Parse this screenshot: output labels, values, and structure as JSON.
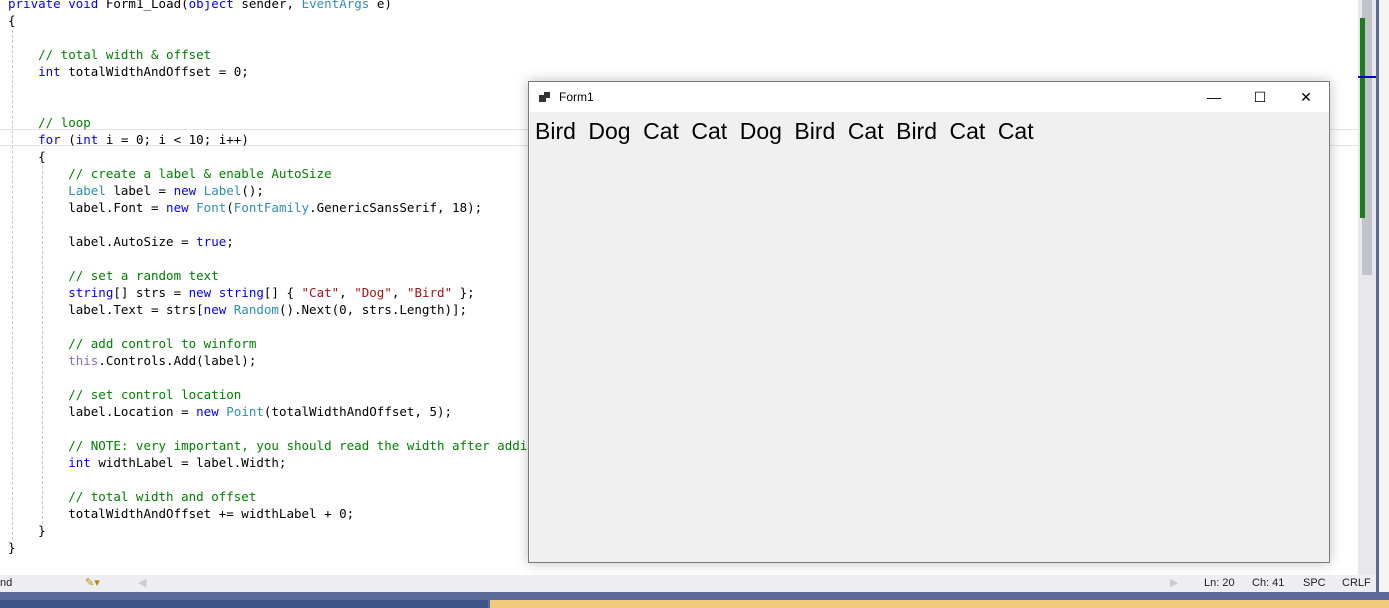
{
  "code_lines": [
    [
      [
        "kw",
        "private "
      ],
      [
        "kw",
        "void "
      ],
      [
        "",
        "Form1_Load("
      ],
      [
        "kw",
        "object "
      ],
      [
        "",
        "sender, "
      ],
      [
        "ty",
        "EventArgs "
      ],
      [
        "",
        "e)"
      ]
    ],
    [
      [
        "",
        "{"
      ]
    ],
    [],
    [
      [
        "cm",
        "    // total width & offset"
      ]
    ],
    [
      [
        "kw",
        "    int "
      ],
      [
        "",
        "totalWidthAndOffset = 0;"
      ]
    ],
    [],
    [],
    [
      [
        "cm",
        "    // loop"
      ]
    ],
    [
      [
        "kw",
        "    for "
      ],
      [
        "",
        "("
      ],
      [
        "kw",
        "int "
      ],
      [
        "",
        "i = 0; i < 10; i++)"
      ]
    ],
    [
      [
        "",
        "    {"
      ]
    ],
    [
      [
        "cm",
        "        // create a label & enable AutoSize"
      ]
    ],
    [
      [
        "ty",
        "        Label "
      ],
      [
        "",
        "label = "
      ],
      [
        "kw",
        "new "
      ],
      [
        "ty",
        "Label"
      ],
      [
        "",
        "();"
      ]
    ],
    [
      [
        "",
        "        label.Font = "
      ],
      [
        "kw",
        "new "
      ],
      [
        "ty",
        "Font"
      ],
      [
        "",
        "("
      ],
      [
        "ty",
        "FontFamily"
      ],
      [
        "",
        ".GenericSansSerif, 18);"
      ]
    ],
    [],
    [
      [
        "",
        "        label.AutoSize = "
      ],
      [
        "kw",
        "true"
      ],
      [
        "",
        ";"
      ]
    ],
    [],
    [
      [
        "cm",
        "        // set a random text"
      ]
    ],
    [
      [
        "kw",
        "        string"
      ],
      [
        "",
        "[] strs = "
      ],
      [
        "kw",
        "new "
      ],
      [
        "kw",
        "string"
      ],
      [
        "",
        "[] { "
      ],
      [
        "st",
        "\"Cat\""
      ],
      [
        "",
        ", "
      ],
      [
        "st",
        "\"Dog\""
      ],
      [
        "",
        ", "
      ],
      [
        "st",
        "\"Bird\""
      ],
      [
        "",
        " };"
      ]
    ],
    [
      [
        "",
        "        label.Text = strs["
      ],
      [
        "kw",
        "new "
      ],
      [
        "ty",
        "Random"
      ],
      [
        "",
        "().Next(0, strs.Length)];"
      ]
    ],
    [],
    [
      [
        "cm",
        "        // add control to winform"
      ]
    ],
    [
      [
        "th",
        "        this"
      ],
      [
        "",
        ".Controls.Add(label);"
      ]
    ],
    [],
    [
      [
        "cm",
        "        // set control location"
      ]
    ],
    [
      [
        "",
        "        label.Location = "
      ],
      [
        "kw",
        "new "
      ],
      [
        "ty",
        "Point"
      ],
      [
        "",
        "(totalWidthAndOffset, 5);"
      ]
    ],
    [],
    [
      [
        "cm",
        "        // NOTE: very important, you should read the width after addi"
      ]
    ],
    [
      [
        "kw",
        "        int "
      ],
      [
        "",
        "widthLabel = label.Width;"
      ]
    ],
    [],
    [
      [
        "cm",
        "        // total width and offset"
      ]
    ],
    [
      [
        "",
        "        totalWidthAndOffset += widthLabel + 0;"
      ]
    ],
    [
      [
        "",
        "    }"
      ]
    ],
    [
      [
        "",
        "}"
      ]
    ]
  ],
  "status": {
    "left_text": "nd",
    "ln": "Ln: 20",
    "ch": "Ch: 41",
    "spc": "SPC",
    "crlf": "CRLF"
  },
  "form": {
    "title": "Form1",
    "labels": [
      "Bird",
      "Dog",
      "Cat",
      "Cat",
      "Dog",
      "Bird",
      "Cat",
      "Bird",
      "Cat",
      "Cat"
    ]
  }
}
